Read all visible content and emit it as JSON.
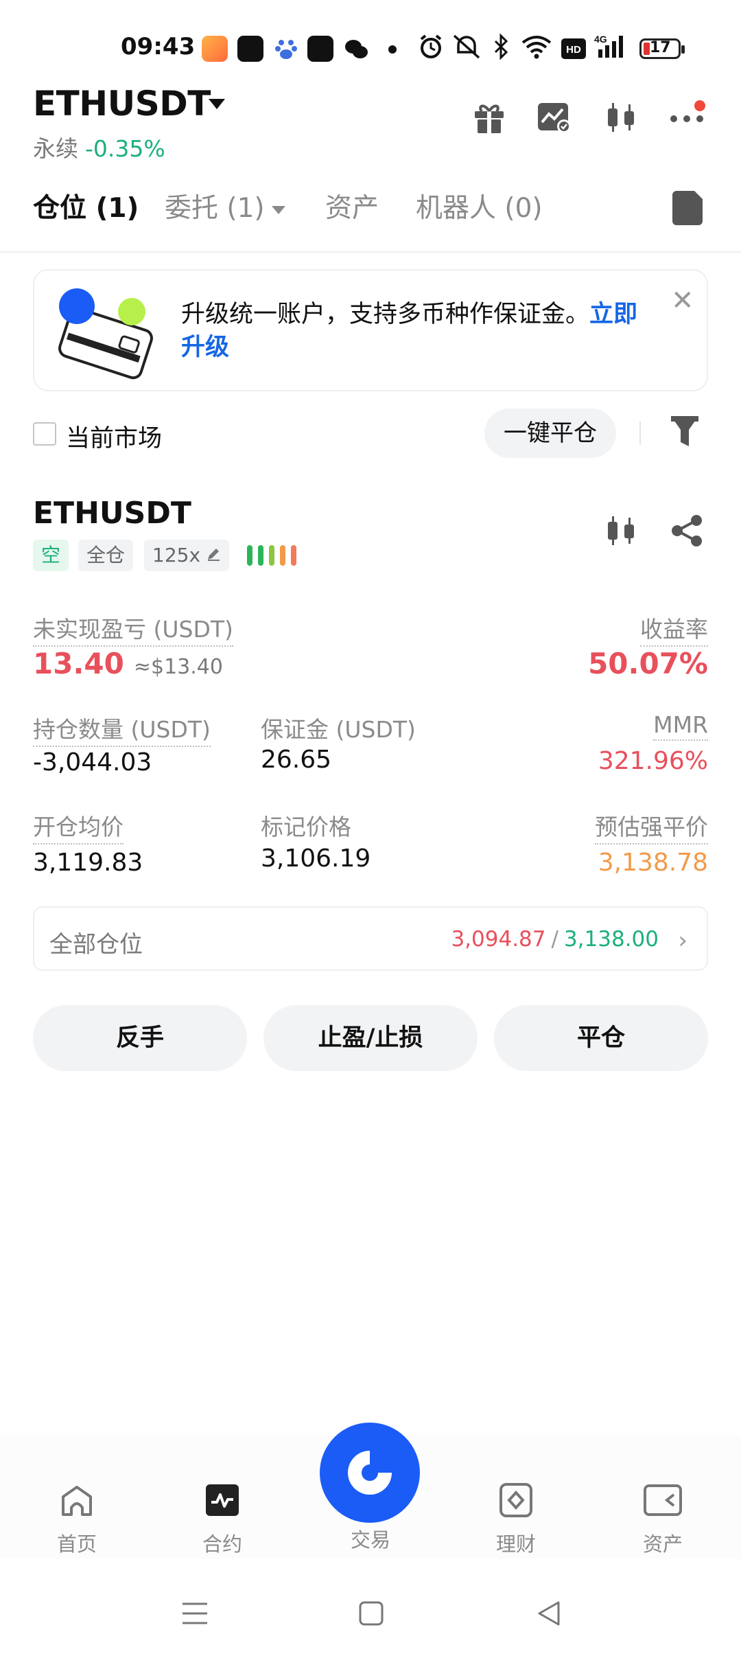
{
  "status_bar": {
    "time": "09:43",
    "battery_level": "17",
    "icons": [
      "app-icon",
      "tiktok-icon",
      "baidu-icon",
      "tiktok-icon",
      "wechat-icon",
      "alarm-icon",
      "mute-icon",
      "bluetooth-icon",
      "wifi-icon",
      "hd-icon",
      "signal-4g-icon",
      "battery-icon"
    ]
  },
  "header": {
    "symbol": "ETHUSDT",
    "contract_type": "永续",
    "change": "-0.35%",
    "icons": [
      "gift-icon",
      "chart-check-icon",
      "candlestick-icon",
      "more-icon"
    ]
  },
  "tabs": [
    {
      "label": "仓位 (1)",
      "active": true
    },
    {
      "label": "委托 (1)",
      "active": false
    },
    {
      "label": "资产",
      "active": false
    },
    {
      "label": "机器人 (0)",
      "active": false
    }
  ],
  "banner": {
    "text": "升级统一账户，支持多币种作保证金。",
    "link": "立即升级"
  },
  "filter": {
    "current_market_label": "当前市场",
    "close_all_label": "一键平仓"
  },
  "position": {
    "symbol": "ETHUSDT",
    "side_tag": "空",
    "margin_mode_tag": "全仓",
    "leverage_tag": "125x",
    "risk_bar_colors": [
      "#2bb55a",
      "#2bb55a",
      "#8cc63f",
      "#f29a4a",
      "#f07a5a"
    ],
    "unrealized_pnl_label": "未实现盈亏 (USDT)",
    "unrealized_pnl": "13.40",
    "unrealized_pnl_usd": "≈$13.40",
    "roe_label": "收益率",
    "roe": "50.07%",
    "size_label": "持仓数量 (USDT)",
    "size": "-3,044.03",
    "margin_label": "保证金 (USDT)",
    "margin": "26.65",
    "mmr_label": "MMR",
    "mmr": "321.96%",
    "entry_label": "开仓均价",
    "entry": "3,119.83",
    "mark_label": "标记价格",
    "mark": "3,106.19",
    "liq_label": "预估强平价",
    "liq": "3,138.78",
    "all_positions_label": "全部仓位",
    "tp": "3,094.87",
    "sl": "3,138.00",
    "actions": [
      "反手",
      "止盈/止损",
      "平仓"
    ]
  },
  "bottom_nav": [
    {
      "label": "首页",
      "icon": "home-icon"
    },
    {
      "label": "合约",
      "icon": "futures-icon"
    },
    {
      "label": "交易",
      "icon": "trade-icon"
    },
    {
      "label": "理财",
      "icon": "earn-icon"
    },
    {
      "label": "资产",
      "icon": "wallet-icon"
    }
  ],
  "colors": {
    "accent_blue": "#1a5cf5",
    "up_green": "#1bb07a",
    "down_red": "#e8505b",
    "warn_orange": "#f29a4a"
  }
}
